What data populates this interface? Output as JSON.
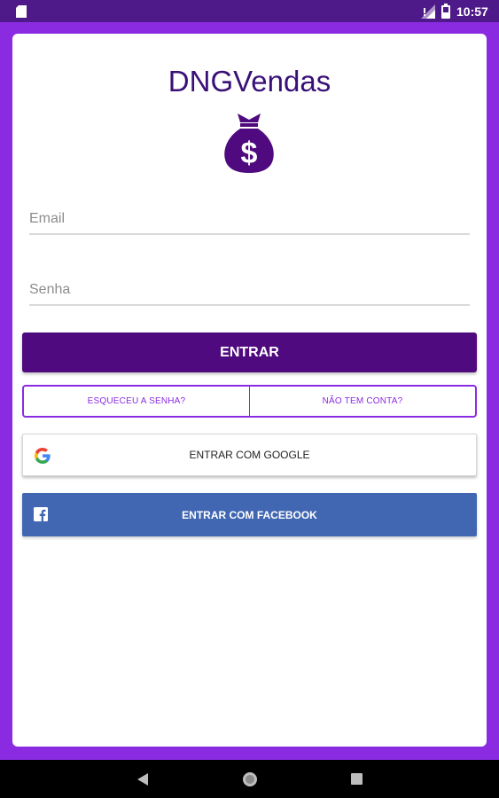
{
  "status_bar": {
    "time": "10:57",
    "icons": [
      "sim-card-icon",
      "signal-no-data-icon",
      "battery-icon"
    ]
  },
  "app": {
    "title": "DNGVendas",
    "logo_icon": "money-bag-dollar-icon"
  },
  "form": {
    "email_placeholder": "Email",
    "email_value": "",
    "password_placeholder": "Senha",
    "password_value": ""
  },
  "buttons": {
    "login_label": "ENTRAR",
    "forgot_password_label": "ESQUECEU A SENHA?",
    "no_account_label": "NÃO TEM CONTA?",
    "google_label": "ENTRAR COM GOOGLE",
    "facebook_label": "ENTRAR COM FACEBOOK"
  },
  "nav_bar": {
    "icons": [
      "back-icon",
      "home-icon",
      "recents-icon"
    ]
  },
  "colors": {
    "status_bar": "#4e1a8a",
    "frame": "#8a2be2",
    "title": "#3a1078",
    "primary_button": "#4e0a7e",
    "accent": "#8a2be2",
    "facebook": "#4267b2",
    "nav_bar": "#000000"
  }
}
